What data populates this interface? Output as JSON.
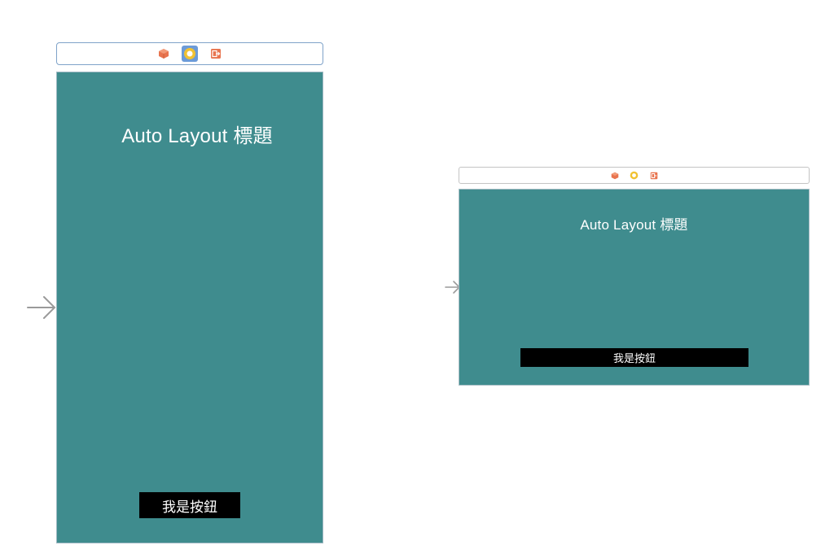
{
  "portrait_scene": {
    "title": "Auto Layout 標題",
    "button_label": "我是按鈕",
    "dock_icons": [
      "view-controller-icon",
      "first-responder-icon",
      "exit-icon"
    ],
    "selected_icon": "first-responder-icon"
  },
  "landscape_scene": {
    "title": "Auto Layout 標題",
    "button_label": "我是按鈕",
    "dock_icons": [
      "view-controller-icon",
      "first-responder-icon",
      "exit-icon"
    ]
  },
  "colors": {
    "view_background": "#3f8c8e",
    "button_background": "#000000",
    "label_text": "#ffffff",
    "icon_orange": "#e8744f",
    "icon_yellow": "#f1c232",
    "selection_blue": "#6c9bd8",
    "entry_arrow": "#9a9a9a"
  }
}
